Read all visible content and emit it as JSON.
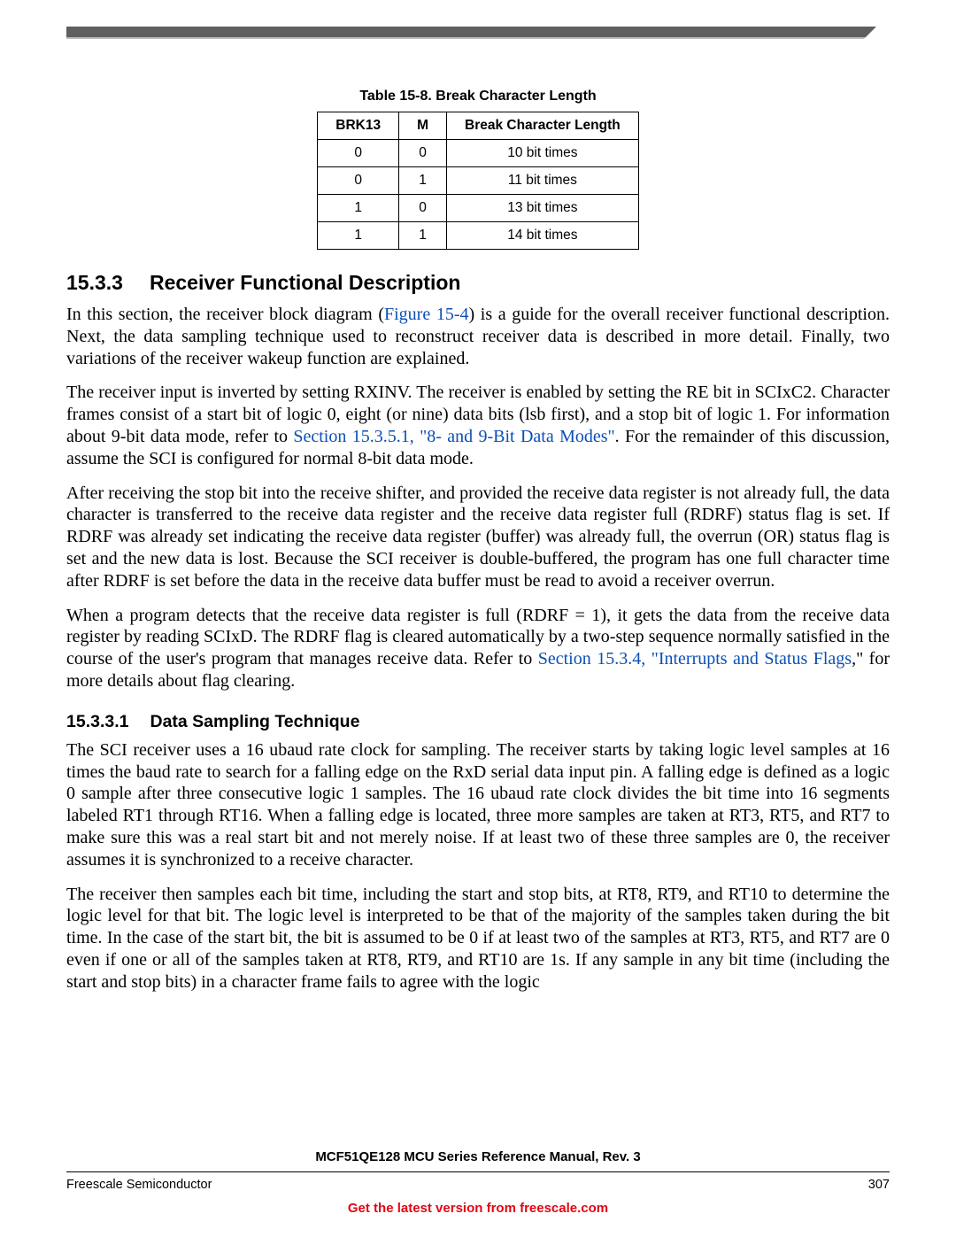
{
  "table": {
    "caption": "Table 15-8. Break Character Length",
    "headers": [
      "BRK13",
      "M",
      "Break Character Length"
    ],
    "rows": [
      [
        "0",
        "0",
        "10 bit times"
      ],
      [
        "0",
        "1",
        "11 bit times"
      ],
      [
        "1",
        "0",
        "13 bit times"
      ],
      [
        "1",
        "1",
        "14 bit times"
      ]
    ]
  },
  "section": {
    "num": "15.3.3",
    "title": "Receiver Functional Description",
    "p1a": "In this section, the receiver block diagram (",
    "p1_link": "Figure 15-4",
    "p1b": ") is a guide for the overall receiver functional description. Next, the data sampling technique used to reconstruct receiver data is described in more detail. Finally, two variations of the receiver wakeup function are explained.",
    "p2a": "The receiver input is inverted by setting RXINV. The receiver is enabled by setting the RE bit in SCIxC2. Character frames consist of a start bit of logic 0, eight (or nine) data bits (lsb first), and a stop bit of logic 1. For information about 9-bit data mode, refer to ",
    "p2_link": "Section 15.3.5.1, \"8- and 9-Bit Data Modes\"",
    "p2b": ". For the remainder of this discussion, assume the SCI is configured for normal 8-bit data mode.",
    "p3": "After receiving the stop bit into the receive shifter, and provided the receive data register is not already full, the data character is transferred to the receive data register and the receive data register full (RDRF) status flag is set. If RDRF was already set indicating the receive data register (buffer) was already full, the overrun (OR) status flag is set and the new data is lost. Because the SCI receiver is double-buffered, the program has one full character time after RDRF is set before the data in the receive data buffer must be read to avoid a receiver overrun.",
    "p4a": "When a program detects that the receive data register is full (RDRF = 1), it gets the data from the receive data register by reading SCIxD. The RDRF flag is cleared automatically by a two-step sequence normally satisfied in the course of the user's program that manages receive data. Refer to ",
    "p4_link": "Section 15.3.4, \"Interrupts and Status Flags",
    "p4b": ",\" for more details about flag clearing."
  },
  "subsection": {
    "num": "15.3.3.1",
    "title": "Data Sampling Technique",
    "p1": "The SCI receiver uses a 16 ubaud rate clock for sampling. The receiver starts by taking logic level samples at 16 times the baud rate to search for a falling edge on the RxD serial data input pin. A falling edge is defined as a logic 0 sample after three consecutive logic 1 samples. The 16 ubaud rate clock divides the bit time into 16 segments labeled RT1 through RT16. When a falling edge is located, three more samples are taken at RT3, RT5, and RT7 to make sure this was a real start bit and not merely noise. If at least two of these three samples are 0, the receiver assumes it is synchronized to a receive character.",
    "p2": "The receiver then samples each bit time, including the start and stop bits, at RT8, RT9, and RT10 to determine the logic level for that bit. The logic level is interpreted to be that of the majority of the samples taken during the bit time. In the case of the start bit, the bit is assumed to be 0 if at least two of the samples at RT3, RT5, and RT7 are 0 even if one or all of the samples taken at RT8, RT9, and RT10 are 1s. If any sample in any bit time (including the start and stop bits) in a character frame fails to agree with the logic"
  },
  "footer": {
    "title": "MCF51QE128 MCU Series Reference Manual, Rev. 3",
    "left": "Freescale Semiconductor",
    "right": "307",
    "link": "Get the latest version from freescale.com"
  }
}
